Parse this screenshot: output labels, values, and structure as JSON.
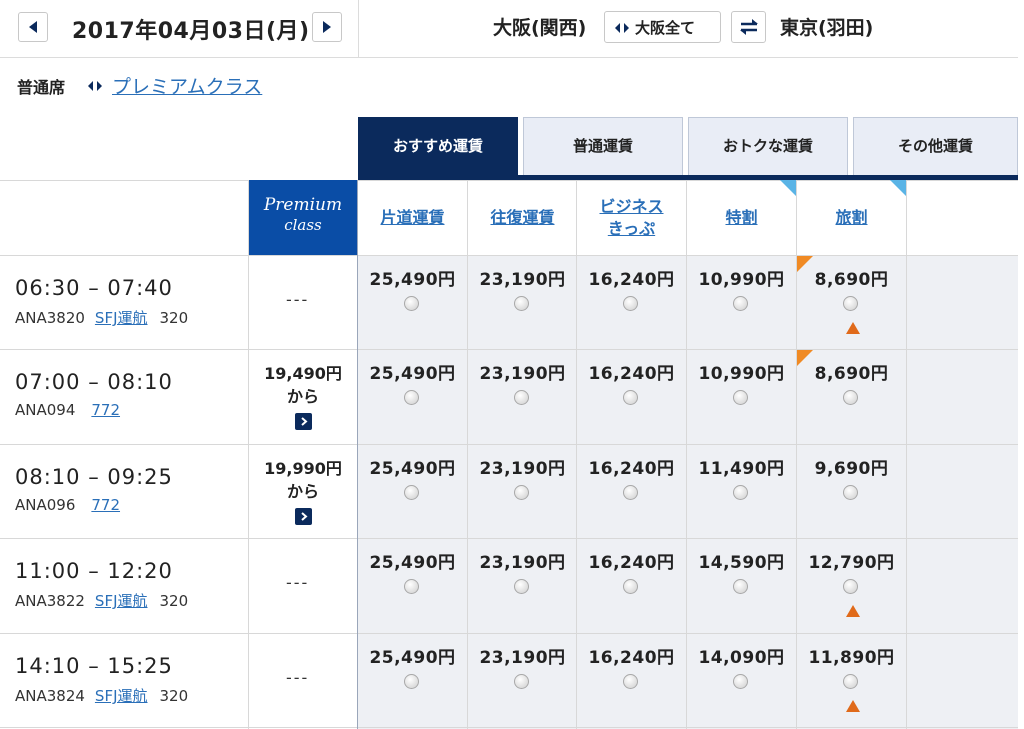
{
  "header": {
    "date": "2017年04月03日(月)",
    "origin": "大阪(関西)",
    "origin_all_label": "大阪全て",
    "destination": "東京(羽田)"
  },
  "class_switch": {
    "current": "普通席",
    "alternate": "プレミアムクラス"
  },
  "tabs": [
    {
      "label": "おすすめ運賃",
      "active": true
    },
    {
      "label": "普通運賃",
      "active": false
    },
    {
      "label": "おトクな運賃",
      "active": false
    },
    {
      "label": "その他運賃",
      "active": false
    }
  ],
  "columns": {
    "premium_line1": "Premium",
    "premium_line2": "class",
    "fares": [
      {
        "line1": "片道運賃",
        "line2": "",
        "corner_mark": false
      },
      {
        "line1": "往復運賃",
        "line2": "",
        "corner_mark": false
      },
      {
        "line1": "ビジネス",
        "line2": "きっぷ",
        "corner_mark": false
      },
      {
        "line1": "特割",
        "line2": "",
        "corner_mark": true
      },
      {
        "line1": "旅割",
        "line2": "",
        "corner_mark": true
      }
    ]
  },
  "flights": [
    {
      "time": "06:30 – 07:40",
      "flight_no": "ANA3820",
      "operator": "SFJ運航",
      "aircraft": "320",
      "premium": {
        "available": false,
        "dash": "---"
      },
      "fares": [
        "25,490円",
        "23,190円",
        "16,240円",
        "10,990円",
        "8,690円"
      ],
      "flag_last": true,
      "warn_last": true
    },
    {
      "time": "07:00 – 08:10",
      "flight_no": "ANA094",
      "operator": "",
      "aircraft": "772",
      "premium": {
        "available": true,
        "price": "19,490円",
        "from": "から"
      },
      "fares": [
        "25,490円",
        "23,190円",
        "16,240円",
        "10,990円",
        "8,690円"
      ],
      "flag_last": true,
      "warn_last": false
    },
    {
      "time": "08:10 – 09:25",
      "flight_no": "ANA096",
      "operator": "",
      "aircraft": "772",
      "premium": {
        "available": true,
        "price": "19,990円",
        "from": "から"
      },
      "fares": [
        "25,490円",
        "23,190円",
        "16,240円",
        "11,490円",
        "9,690円"
      ],
      "flag_last": false,
      "warn_last": false
    },
    {
      "time": "11:00 – 12:20",
      "flight_no": "ANA3822",
      "operator": "SFJ運航",
      "aircraft": "320",
      "premium": {
        "available": false,
        "dash": "---"
      },
      "fares": [
        "25,490円",
        "23,190円",
        "16,240円",
        "14,590円",
        "12,790円"
      ],
      "flag_last": false,
      "warn_last": true
    },
    {
      "time": "14:10 – 15:25",
      "flight_no": "ANA3824",
      "operator": "SFJ運航",
      "aircraft": "320",
      "premium": {
        "available": false,
        "dash": "---"
      },
      "fares": [
        "25,490円",
        "23,190円",
        "16,240円",
        "14,090円",
        "11,890円"
      ],
      "flag_last": false,
      "warn_last": true
    }
  ],
  "colors": {
    "navy": "#0b2a5c",
    "premium_blue": "#0a4da6",
    "link": "#2a6fb8",
    "warning": "#e06a1a",
    "flag": "#f08a24",
    "corner": "#5ab4e6"
  }
}
